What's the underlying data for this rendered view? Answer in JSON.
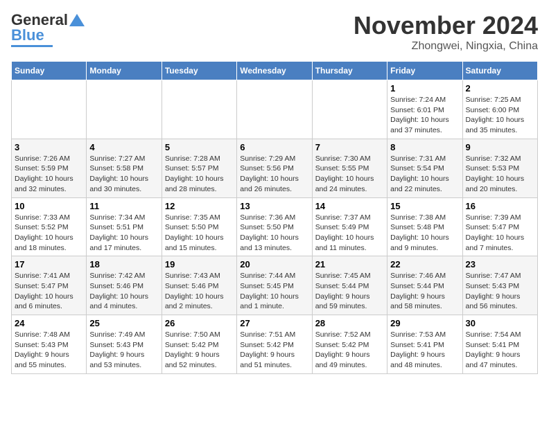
{
  "header": {
    "logo_line1": "General",
    "logo_line2": "Blue",
    "title": "November 2024",
    "subtitle": "Zhongwei, Ningxia, China"
  },
  "weekdays": [
    "Sunday",
    "Monday",
    "Tuesday",
    "Wednesday",
    "Thursday",
    "Friday",
    "Saturday"
  ],
  "weeks": [
    [
      {
        "day": "",
        "info": ""
      },
      {
        "day": "",
        "info": ""
      },
      {
        "day": "",
        "info": ""
      },
      {
        "day": "",
        "info": ""
      },
      {
        "day": "",
        "info": ""
      },
      {
        "day": "1",
        "info": "Sunrise: 7:24 AM\nSunset: 6:01 PM\nDaylight: 10 hours\nand 37 minutes."
      },
      {
        "day": "2",
        "info": "Sunrise: 7:25 AM\nSunset: 6:00 PM\nDaylight: 10 hours\nand 35 minutes."
      }
    ],
    [
      {
        "day": "3",
        "info": "Sunrise: 7:26 AM\nSunset: 5:59 PM\nDaylight: 10 hours\nand 32 minutes."
      },
      {
        "day": "4",
        "info": "Sunrise: 7:27 AM\nSunset: 5:58 PM\nDaylight: 10 hours\nand 30 minutes."
      },
      {
        "day": "5",
        "info": "Sunrise: 7:28 AM\nSunset: 5:57 PM\nDaylight: 10 hours\nand 28 minutes."
      },
      {
        "day": "6",
        "info": "Sunrise: 7:29 AM\nSunset: 5:56 PM\nDaylight: 10 hours\nand 26 minutes."
      },
      {
        "day": "7",
        "info": "Sunrise: 7:30 AM\nSunset: 5:55 PM\nDaylight: 10 hours\nand 24 minutes."
      },
      {
        "day": "8",
        "info": "Sunrise: 7:31 AM\nSunset: 5:54 PM\nDaylight: 10 hours\nand 22 minutes."
      },
      {
        "day": "9",
        "info": "Sunrise: 7:32 AM\nSunset: 5:53 PM\nDaylight: 10 hours\nand 20 minutes."
      }
    ],
    [
      {
        "day": "10",
        "info": "Sunrise: 7:33 AM\nSunset: 5:52 PM\nDaylight: 10 hours\nand 18 minutes."
      },
      {
        "day": "11",
        "info": "Sunrise: 7:34 AM\nSunset: 5:51 PM\nDaylight: 10 hours\nand 17 minutes."
      },
      {
        "day": "12",
        "info": "Sunrise: 7:35 AM\nSunset: 5:50 PM\nDaylight: 10 hours\nand 15 minutes."
      },
      {
        "day": "13",
        "info": "Sunrise: 7:36 AM\nSunset: 5:50 PM\nDaylight: 10 hours\nand 13 minutes."
      },
      {
        "day": "14",
        "info": "Sunrise: 7:37 AM\nSunset: 5:49 PM\nDaylight: 10 hours\nand 11 minutes."
      },
      {
        "day": "15",
        "info": "Sunrise: 7:38 AM\nSunset: 5:48 PM\nDaylight: 10 hours\nand 9 minutes."
      },
      {
        "day": "16",
        "info": "Sunrise: 7:39 AM\nSunset: 5:47 PM\nDaylight: 10 hours\nand 7 minutes."
      }
    ],
    [
      {
        "day": "17",
        "info": "Sunrise: 7:41 AM\nSunset: 5:47 PM\nDaylight: 10 hours\nand 6 minutes."
      },
      {
        "day": "18",
        "info": "Sunrise: 7:42 AM\nSunset: 5:46 PM\nDaylight: 10 hours\nand 4 minutes."
      },
      {
        "day": "19",
        "info": "Sunrise: 7:43 AM\nSunset: 5:46 PM\nDaylight: 10 hours\nand 2 minutes."
      },
      {
        "day": "20",
        "info": "Sunrise: 7:44 AM\nSunset: 5:45 PM\nDaylight: 10 hours\nand 1 minute."
      },
      {
        "day": "21",
        "info": "Sunrise: 7:45 AM\nSunset: 5:44 PM\nDaylight: 9 hours\nand 59 minutes."
      },
      {
        "day": "22",
        "info": "Sunrise: 7:46 AM\nSunset: 5:44 PM\nDaylight: 9 hours\nand 58 minutes."
      },
      {
        "day": "23",
        "info": "Sunrise: 7:47 AM\nSunset: 5:43 PM\nDaylight: 9 hours\nand 56 minutes."
      }
    ],
    [
      {
        "day": "24",
        "info": "Sunrise: 7:48 AM\nSunset: 5:43 PM\nDaylight: 9 hours\nand 55 minutes."
      },
      {
        "day": "25",
        "info": "Sunrise: 7:49 AM\nSunset: 5:43 PM\nDaylight: 9 hours\nand 53 minutes."
      },
      {
        "day": "26",
        "info": "Sunrise: 7:50 AM\nSunset: 5:42 PM\nDaylight: 9 hours\nand 52 minutes."
      },
      {
        "day": "27",
        "info": "Sunrise: 7:51 AM\nSunset: 5:42 PM\nDaylight: 9 hours\nand 51 minutes."
      },
      {
        "day": "28",
        "info": "Sunrise: 7:52 AM\nSunset: 5:42 PM\nDaylight: 9 hours\nand 49 minutes."
      },
      {
        "day": "29",
        "info": "Sunrise: 7:53 AM\nSunset: 5:41 PM\nDaylight: 9 hours\nand 48 minutes."
      },
      {
        "day": "30",
        "info": "Sunrise: 7:54 AM\nSunset: 5:41 PM\nDaylight: 9 hours\nand 47 minutes."
      }
    ]
  ]
}
